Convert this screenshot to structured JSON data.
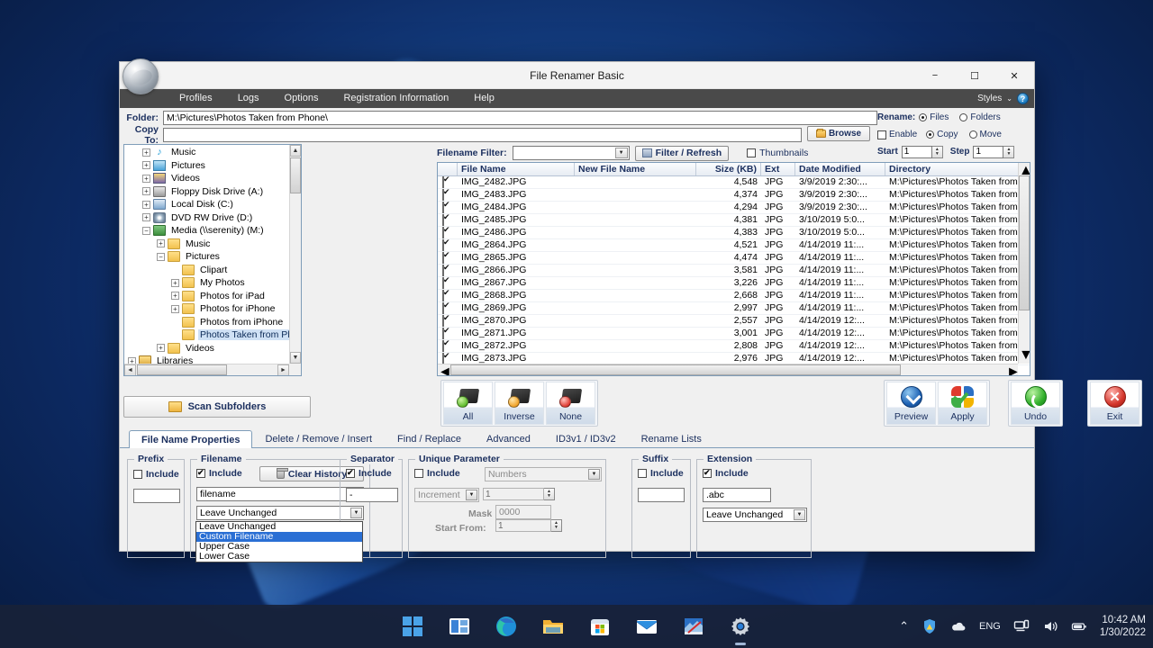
{
  "window": {
    "title": "File Renamer Basic",
    "minimize": "−",
    "maximize": "☐",
    "close": "✕"
  },
  "menu": {
    "items": [
      "Profiles",
      "Logs",
      "Options",
      "Registration Information",
      "Help"
    ],
    "styles_label": "Styles",
    "styles_caret": "⌄",
    "help_glyph": "?"
  },
  "paths": {
    "folder_label": "Folder:",
    "folder_value": "M:\\Pictures\\Photos Taken from Phone\\",
    "copy_to_label": "Copy To:",
    "copy_to_value": "",
    "browse_label": "Browse"
  },
  "rename_options": {
    "rename_label": "Rename:",
    "files_label": "Files",
    "files_selected": true,
    "folders_label": "Folders",
    "folders_selected": false,
    "enable_label": "Enable",
    "enable_checked": false,
    "copy_label": "Copy",
    "copy_selected": true,
    "move_label": "Move",
    "move_selected": false,
    "start_label": "Start",
    "start_value": "1",
    "step_label": "Step",
    "step_value": "1"
  },
  "filter_bar": {
    "filename_filter_label": "Filename Filter:",
    "filter_value": "",
    "filter_refresh_label": "Filter / Refresh",
    "thumbnails_label": "Thumbnails",
    "thumbnails_checked": false
  },
  "tree": {
    "nodes": [
      {
        "label": "Music",
        "indent": 1,
        "expander": "+",
        "icon": "music-note-icon",
        "selected": false
      },
      {
        "label": "Pictures",
        "indent": 1,
        "expander": "+",
        "icon": "pictures-folder-icon",
        "selected": false
      },
      {
        "label": "Videos",
        "indent": 1,
        "expander": "+",
        "icon": "videos-folder-icon",
        "selected": false
      },
      {
        "label": "Floppy Disk Drive (A:)",
        "indent": 1,
        "expander": "+",
        "icon": "floppy-drive-icon",
        "selected": false
      },
      {
        "label": "Local Disk (C:)",
        "indent": 1,
        "expander": "+",
        "icon": "local-disk-icon",
        "selected": false
      },
      {
        "label": "DVD RW Drive (D:)",
        "indent": 1,
        "expander": "+",
        "icon": "dvd-drive-icon",
        "selected": false
      },
      {
        "label": "Media (\\\\serenity) (M:)",
        "indent": 1,
        "expander": "−",
        "icon": "network-drive-icon",
        "selected": false
      },
      {
        "label": "Music",
        "indent": 2,
        "expander": "+",
        "icon": "folder-icon",
        "selected": false
      },
      {
        "label": "Pictures",
        "indent": 2,
        "expander": "−",
        "icon": "folder-icon",
        "selected": false
      },
      {
        "label": "Clipart",
        "indent": 3,
        "expander": "",
        "icon": "folder-icon",
        "selected": false
      },
      {
        "label": "My Photos",
        "indent": 3,
        "expander": "+",
        "icon": "folder-icon",
        "selected": false
      },
      {
        "label": "Photos for iPad",
        "indent": 3,
        "expander": "+",
        "icon": "folder-icon",
        "selected": false
      },
      {
        "label": "Photos for iPhone",
        "indent": 3,
        "expander": "+",
        "icon": "folder-icon",
        "selected": false
      },
      {
        "label": "Photos from iPhone",
        "indent": 3,
        "expander": "",
        "icon": "folder-icon",
        "selected": false
      },
      {
        "label": "Photos Taken from Phone",
        "indent": 3,
        "expander": "",
        "icon": "folder-icon",
        "selected": true
      },
      {
        "label": "Videos",
        "indent": 2,
        "expander": "+",
        "icon": "folder-icon",
        "selected": false
      },
      {
        "label": "Libraries",
        "indent": 0,
        "expander": "+",
        "icon": "libraries-icon",
        "selected": false
      }
    ]
  },
  "file_list": {
    "columns": [
      "",
      "File Name",
      "New File Name",
      "Size (KB)",
      "Ext",
      "Date Modified",
      "Directory"
    ],
    "rows": [
      {
        "checked": true,
        "name": "IMG_2482.JPG",
        "new_name": "",
        "size": "4,548",
        "ext": "JPG",
        "date": "3/9/2019 2:30:...",
        "dir": "M:\\Pictures\\Photos Taken from Phone\\"
      },
      {
        "checked": true,
        "name": "IMG_2483.JPG",
        "new_name": "",
        "size": "4,374",
        "ext": "JPG",
        "date": "3/9/2019 2:30:...",
        "dir": "M:\\Pictures\\Photos Taken from Phone\\"
      },
      {
        "checked": true,
        "name": "IMG_2484.JPG",
        "new_name": "",
        "size": "4,294",
        "ext": "JPG",
        "date": "3/9/2019 2:30:...",
        "dir": "M:\\Pictures\\Photos Taken from Phone\\"
      },
      {
        "checked": true,
        "name": "IMG_2485.JPG",
        "new_name": "",
        "size": "4,381",
        "ext": "JPG",
        "date": "3/10/2019 5:0...",
        "dir": "M:\\Pictures\\Photos Taken from Phone\\"
      },
      {
        "checked": true,
        "name": "IMG_2486.JPG",
        "new_name": "",
        "size": "4,383",
        "ext": "JPG",
        "date": "3/10/2019 5:0...",
        "dir": "M:\\Pictures\\Photos Taken from Phone\\"
      },
      {
        "checked": true,
        "name": "IMG_2864.JPG",
        "new_name": "",
        "size": "4,521",
        "ext": "JPG",
        "date": "4/14/2019 11:...",
        "dir": "M:\\Pictures\\Photos Taken from Phone\\"
      },
      {
        "checked": true,
        "name": "IMG_2865.JPG",
        "new_name": "",
        "size": "4,474",
        "ext": "JPG",
        "date": "4/14/2019 11:...",
        "dir": "M:\\Pictures\\Photos Taken from Phone\\"
      },
      {
        "checked": true,
        "name": "IMG_2866.JPG",
        "new_name": "",
        "size": "3,581",
        "ext": "JPG",
        "date": "4/14/2019 11:...",
        "dir": "M:\\Pictures\\Photos Taken from Phone\\"
      },
      {
        "checked": true,
        "name": "IMG_2867.JPG",
        "new_name": "",
        "size": "3,226",
        "ext": "JPG",
        "date": "4/14/2019 11:...",
        "dir": "M:\\Pictures\\Photos Taken from Phone\\"
      },
      {
        "checked": true,
        "name": "IMG_2868.JPG",
        "new_name": "",
        "size": "2,668",
        "ext": "JPG",
        "date": "4/14/2019 11:...",
        "dir": "M:\\Pictures\\Photos Taken from Phone\\"
      },
      {
        "checked": true,
        "name": "IMG_2869.JPG",
        "new_name": "",
        "size": "2,997",
        "ext": "JPG",
        "date": "4/14/2019 11:...",
        "dir": "M:\\Pictures\\Photos Taken from Phone\\"
      },
      {
        "checked": true,
        "name": "IMG_2870.JPG",
        "new_name": "",
        "size": "2,557",
        "ext": "JPG",
        "date": "4/14/2019 12:...",
        "dir": "M:\\Pictures\\Photos Taken from Phone\\"
      },
      {
        "checked": true,
        "name": "IMG_2871.JPG",
        "new_name": "",
        "size": "3,001",
        "ext": "JPG",
        "date": "4/14/2019 12:...",
        "dir": "M:\\Pictures\\Photos Taken from Phone\\"
      },
      {
        "checked": true,
        "name": "IMG_2872.JPG",
        "new_name": "",
        "size": "2,808",
        "ext": "JPG",
        "date": "4/14/2019 12:...",
        "dir": "M:\\Pictures\\Photos Taken from Phone\\"
      },
      {
        "checked": true,
        "name": "IMG_2873.JPG",
        "new_name": "",
        "size": "2,976",
        "ext": "JPG",
        "date": "4/14/2019 12:...",
        "dir": "M:\\Pictures\\Photos Taken from Phone\\"
      }
    ]
  },
  "actions": {
    "scan_subfolders": "Scan Subfolders",
    "select_all": "All",
    "select_inverse": "Inverse",
    "select_none": "None",
    "preview": "Preview",
    "apply": "Apply",
    "undo": "Undo",
    "exit": "Exit"
  },
  "tabs": [
    {
      "label": "File Name Properties",
      "active": true
    },
    {
      "label": "Delete / Remove / Insert",
      "active": false
    },
    {
      "label": "Find / Replace",
      "active": false
    },
    {
      "label": "Advanced",
      "active": false
    },
    {
      "label": "ID3v1 / ID3v2",
      "active": false
    },
    {
      "label": "Rename Lists",
      "active": false
    }
  ],
  "properties": {
    "prefix": {
      "title": "Prefix",
      "include_label": "Include",
      "include_checked": false,
      "value": ""
    },
    "filename": {
      "title": "Filename",
      "include_label": "Include",
      "include_checked": true,
      "clear_history_label": "Clear History",
      "source_value": "filename",
      "case_value": "Leave Unchanged",
      "dropdown_open": true,
      "dropdown_options": [
        {
          "label": "Leave Unchanged",
          "selected": false
        },
        {
          "label": "Custom Filename",
          "selected": true
        },
        {
          "label": "Upper Case",
          "selected": false
        },
        {
          "label": "Lower Case",
          "selected": false
        }
      ]
    },
    "separator": {
      "title": "Separator",
      "include_label": "Include",
      "include_checked": true,
      "value": "-"
    },
    "unique_parameter": {
      "title": "Unique Parameter",
      "include_label": "Include",
      "include_checked": false,
      "type_value": "Numbers",
      "mode_value": "Increment",
      "step_value": "1",
      "mask_label": "Mask",
      "mask_value": "0000",
      "start_from_label": "Start From:",
      "start_from_value": "1"
    },
    "suffix": {
      "title": "Suffix",
      "include_label": "Include",
      "include_checked": false,
      "value": ""
    },
    "extension": {
      "title": "Extension",
      "include_label": "Include",
      "include_checked": true,
      "value": ".abc",
      "case_value": "Leave Unchanged"
    }
  },
  "taskbar": {
    "icons": [
      "start-icon",
      "task-view-icon",
      "edge-browser-icon",
      "file-explorer-icon",
      "microsoft-store-icon",
      "mail-icon",
      "photo-editor-icon",
      "settings-icon"
    ],
    "chevron": "⌃",
    "language": "ENG",
    "time": "10:42 AM",
    "date": "1/30/2022"
  }
}
